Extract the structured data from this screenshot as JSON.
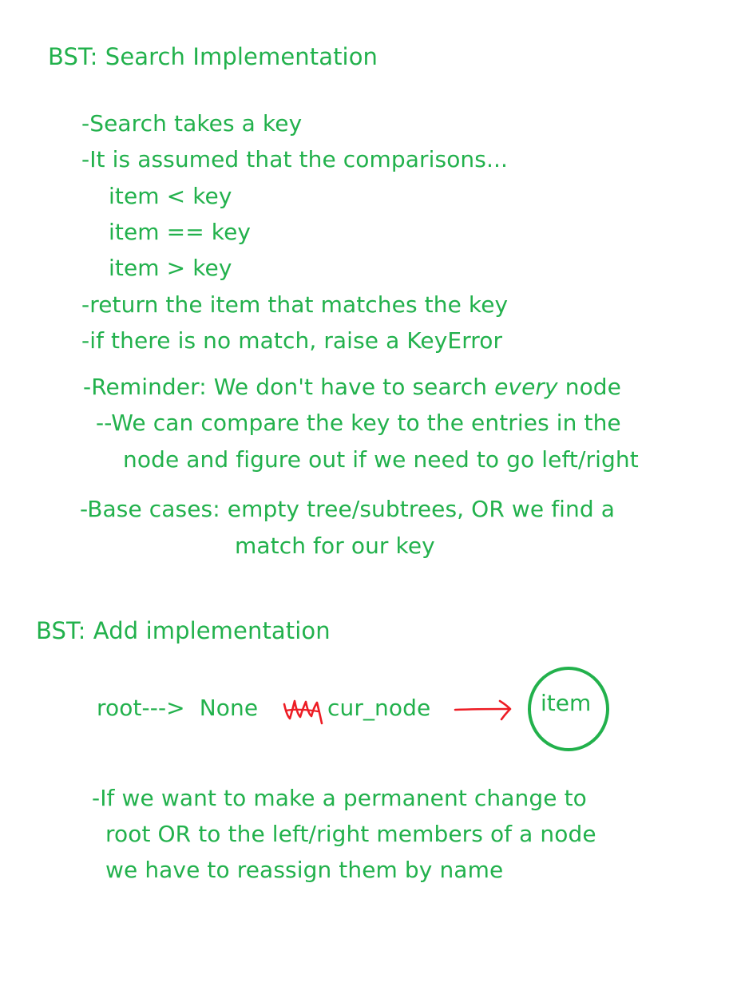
{
  "colors": {
    "ink": "#22b14c",
    "annotation_red": "#ed1c24"
  },
  "search_section": {
    "heading": "BST: Search Implementation",
    "bullets": {
      "takes_key": "-Search takes a key",
      "assumed": "-It is assumed that the comparisons...",
      "cmp_less": "item < key",
      "cmp_equal": "item == key",
      "cmp_greater": "item > key",
      "return_match": "-return the item that matches the key",
      "no_match": "-if there is no match, raise a KeyError",
      "reminder_prefix": "-Reminder: We don't have to search ",
      "reminder_emphasis": "every",
      "reminder_suffix": " node",
      "compare_line1": "--We can compare the key to the entries in the",
      "compare_line2": "node and figure out if we need to go left/right",
      "base_cases_line1": "-Base cases: empty tree/subtrees, OR we find a",
      "base_cases_line2": "match for our key"
    }
  },
  "add_section": {
    "heading": "BST: Add implementation",
    "diagram": {
      "root_label": "root--->  None",
      "cur_node_label": "cur_node",
      "node_label": "item",
      "scribble": "scribble-icon",
      "arrow": "arrow-right-icon",
      "node_shape": "circle-node-icon"
    },
    "notes": {
      "line1": "-If we want to make a permanent change to",
      "line2": "root OR to the left/right members of a node",
      "line3": "we have to reassign them by name"
    }
  }
}
